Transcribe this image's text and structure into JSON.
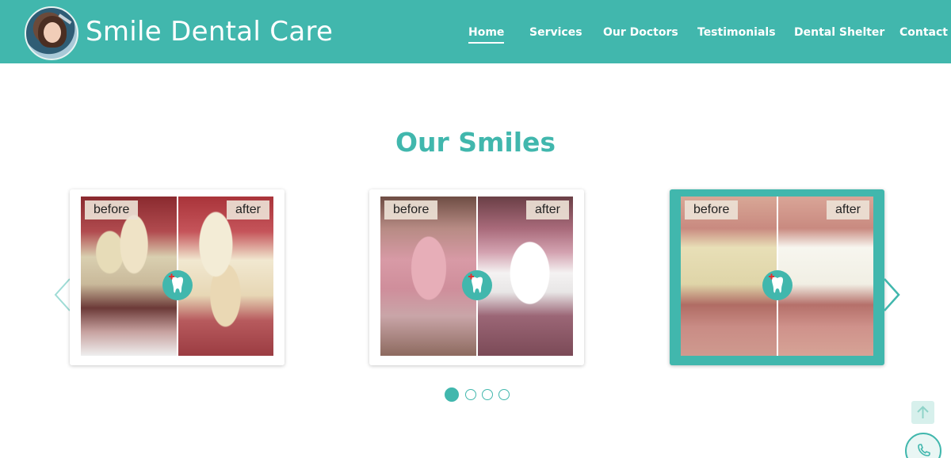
{
  "brand": {
    "name": "Smile Dental Care",
    "logo_icon": "dentist-patient-photo"
  },
  "nav": {
    "items": [
      {
        "label": "Home",
        "active": true
      },
      {
        "label": "Services",
        "active": false
      },
      {
        "label": "Our Doctors",
        "active": false
      },
      {
        "label": "Testimonials",
        "active": false
      },
      {
        "label": "Dental Shelter",
        "active": false
      },
      {
        "label": "Contact",
        "active": false
      }
    ]
  },
  "section": {
    "title": "Our Smiles"
  },
  "gallery": {
    "cards": [
      {
        "before_label": "before",
        "after_label": "after",
        "badge_icon": "tooth-icon"
      },
      {
        "before_label": "before",
        "after_label": "after",
        "badge_icon": "tooth-icon"
      },
      {
        "before_label": "before",
        "after_label": "after",
        "badge_icon": "tooth-icon",
        "highlighted": true
      }
    ],
    "prev_icon": "chevron-left-icon",
    "next_icon": "chevron-right-icon",
    "pagination": {
      "total": 4,
      "active": 1
    }
  },
  "floating": {
    "scroll_top_icon": "arrow-up-icon",
    "call_icon": "phone-icon"
  },
  "colors": {
    "accent": "#41b7ad",
    "text_on_accent": "#ffffff"
  }
}
